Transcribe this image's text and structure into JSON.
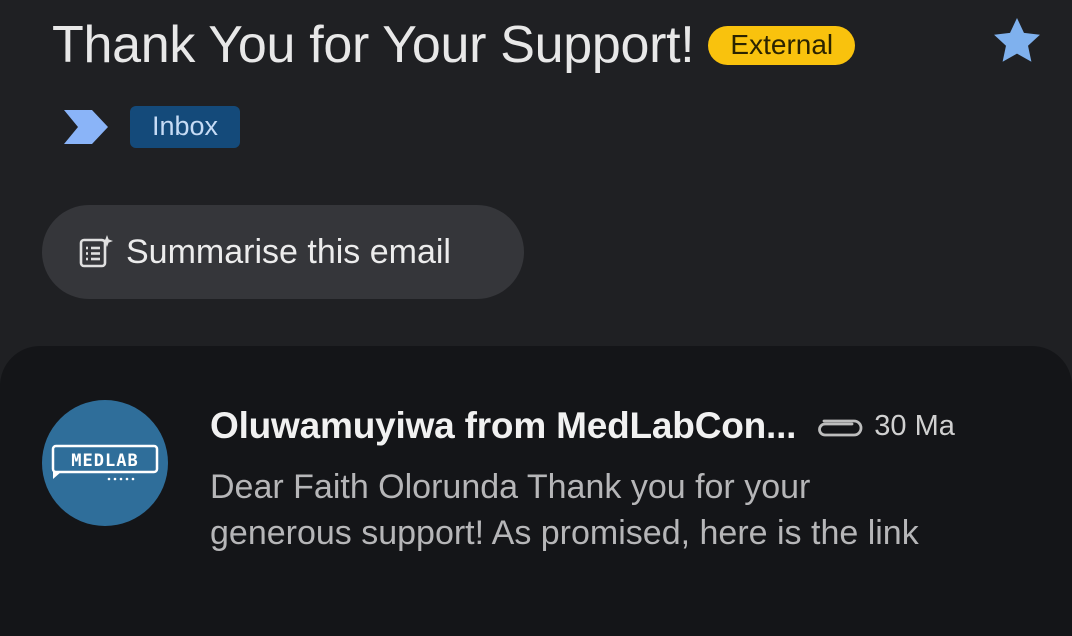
{
  "header": {
    "subject": "Thank You for Your Support!",
    "external_badge": "External",
    "star_icon": "star-icon",
    "starred": true,
    "importance_icon": "importance-marker-icon",
    "label": "Inbox"
  },
  "actions": {
    "summarise_icon": "summarise-icon",
    "summarise_label": "Summarise this email"
  },
  "message": {
    "avatar_text": "MEDLAB",
    "sender": "Oluwamuyiwa from MedLabCon...",
    "attachment_icon": "paperclip-icon",
    "date": "30 Ma",
    "snippet_line1": "Dear Faith Olorunda Thank you for your",
    "snippet_line2": "generous support! As promised, here is the link"
  },
  "colors": {
    "background": "#1f2023",
    "card": "#141518",
    "external_badge": "#f9c20d",
    "inbox_chip": "#144a7a",
    "star": "#7fb1ee",
    "importance": "#8ab4f8",
    "avatar": "#2f6e9a"
  }
}
